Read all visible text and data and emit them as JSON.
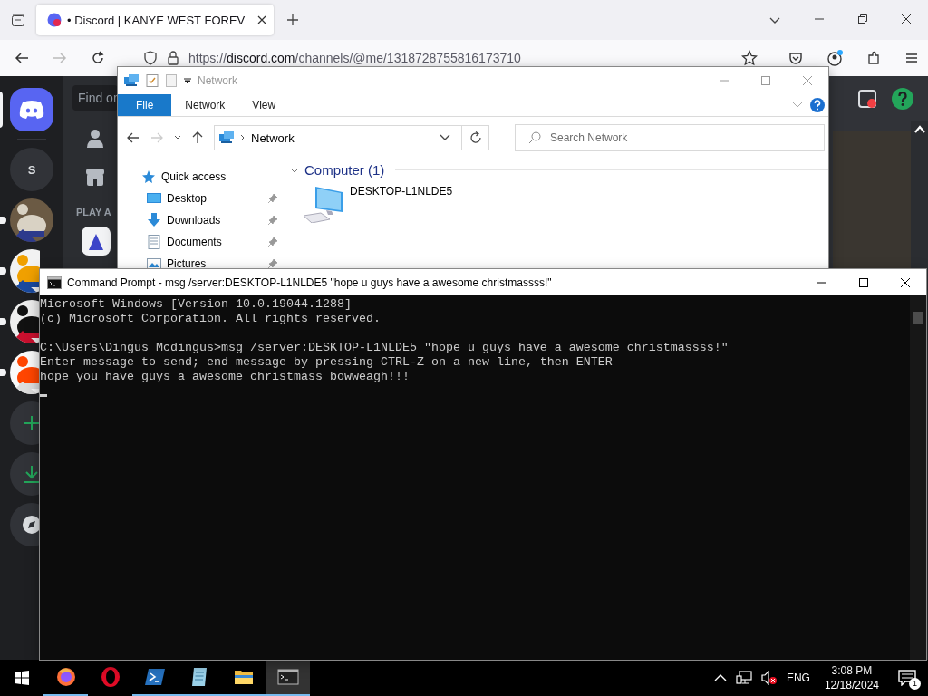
{
  "browser": {
    "tab": {
      "title": "• Discord | KANYE WEST FOREV",
      "selected": true
    },
    "url": {
      "prefix": "https://",
      "host": "discord.com",
      "path": "/channels/@me/1318728755816173710"
    }
  },
  "discord": {
    "search_placeholder": "Find or",
    "section_title": "PLAY A",
    "servers": [
      {
        "kind": "home",
        "selected": true,
        "unread": false
      },
      {
        "kind": "letter",
        "label": "S",
        "selected": false,
        "unread": false
      },
      {
        "kind": "picture",
        "selected": false,
        "unread": true
      },
      {
        "kind": "picture",
        "selected": false,
        "unread": true
      },
      {
        "kind": "picture",
        "selected": false,
        "unread": true
      },
      {
        "kind": "picture",
        "selected": false,
        "unread": true
      },
      {
        "kind": "add",
        "selected": false,
        "unread": false
      },
      {
        "kind": "download",
        "selected": false,
        "unread": false
      },
      {
        "kind": "discover",
        "selected": false,
        "unread": false
      }
    ]
  },
  "explorer": {
    "title": "Network",
    "ribbon_tabs": [
      {
        "label": "File",
        "selected": true
      },
      {
        "label": "Network",
        "selected": false
      },
      {
        "label": "View",
        "selected": false
      }
    ],
    "address": "Network",
    "search": {
      "placeholder": "Search Network"
    },
    "nav": [
      {
        "label": "Quick access",
        "kind": "star",
        "pinned": false
      },
      {
        "label": "Desktop",
        "kind": "desktop",
        "pinned": true
      },
      {
        "label": "Downloads",
        "kind": "download",
        "pinned": true
      },
      {
        "label": "Documents",
        "kind": "document",
        "pinned": true
      },
      {
        "label": "Pictures",
        "kind": "pictures",
        "pinned": true
      }
    ],
    "group": {
      "title": "Computer (1)",
      "items": [
        {
          "label": "DESKTOP-L1NLDE5"
        }
      ]
    }
  },
  "cmd": {
    "title": "Command Prompt - msg  /server:DESKTOP-L1NLDE5 \"hope u guys have a awesome christmassss!\"",
    "lines": [
      {
        "text": "Microsoft Windows [Version 10.0.19044.1288]",
        "blank_before": false
      },
      {
        "text": "(c) Microsoft Corporation. All rights reserved.",
        "blank_before": false
      },
      {
        "text": "C:\\Users\\Dingus Mcdingus>msg /server:DESKTOP-L1NLDE5 \"hope u guys have a awesome christmassss!\"",
        "blank_before": true
      },
      {
        "text": "Enter message to send; end message by pressing CTRL-Z on a new line, then ENTER",
        "blank_before": false
      },
      {
        "text": "hope you have guys a awesome christmass bowweagh!!!",
        "blank_before": false
      }
    ]
  },
  "taskbar": {
    "apps": [
      {
        "kind": "firefox",
        "running": true,
        "active": false
      },
      {
        "kind": "opera",
        "running": false,
        "active": false
      },
      {
        "kind": "powershell",
        "running": true,
        "active": false
      },
      {
        "kind": "notepad",
        "running": true,
        "active": false
      },
      {
        "kind": "explorer",
        "running": true,
        "active": false
      },
      {
        "kind": "terminal",
        "running": true,
        "active": true
      }
    ],
    "muted": true,
    "language": "ENG",
    "time": "3:08 PM",
    "date": "12/18/2024",
    "notifications": "1"
  }
}
